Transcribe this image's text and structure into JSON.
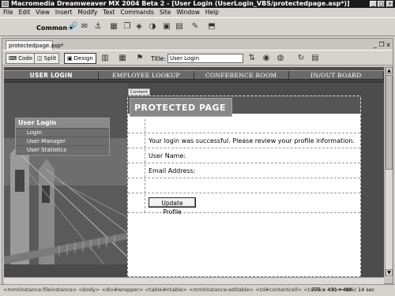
{
  "window": {
    "title": "Macromedia Dreamweaver MX 2004 Beta 2 - [User Login (UserLogin_VBS/protectedpage.asp*)]",
    "controls": [
      "_",
      "□",
      "x"
    ]
  },
  "menubar": {
    "items": [
      "File",
      "Edit",
      "View",
      "Insert",
      "Modify",
      "Text",
      "Commands",
      "Site",
      "Window",
      "Help"
    ]
  },
  "insert_toolbar": {
    "category": "Common",
    "icons": [
      "link-icon",
      "email-icon",
      "anchor-icon",
      "table-icon",
      "layer-icon",
      "image-icon",
      "media-icon",
      "date-icon",
      "server-side-include-icon",
      "tag-chooser-icon"
    ]
  },
  "document": {
    "tab_name": "protectedpage.asp*",
    "window_controls": "_ ❐ x",
    "view_buttons": {
      "code": "Code",
      "split": "Split",
      "design": "Design"
    },
    "title_label": "Title:",
    "title_value": "User Login"
  },
  "page": {
    "nav": [
      "USER LOGIN",
      "EMPLOYEE LOOKUP",
      "CONFERENCE ROOM",
      "IN/OUT BOARD"
    ],
    "user_menu": {
      "title": "User Login",
      "items": [
        "Login",
        "User Manager",
        "User Statistics"
      ]
    },
    "content_label": "Content",
    "header": "PROTECTED PAGE",
    "message": "Your login was successful. Please review your profile information.",
    "user_name_label": "User Name:",
    "email_label": "Email Address:",
    "update_button": "Update Profile"
  },
  "statusbar": {
    "tag_path": "<mmtinstance:fileinstance> <body> <div#wrapper> <table#ntable> <mmtinstance:editable> <td#contentcell> <table> <tr> <td>",
    "info": "775 x 431 ▾ 48K / 14 sec"
  }
}
